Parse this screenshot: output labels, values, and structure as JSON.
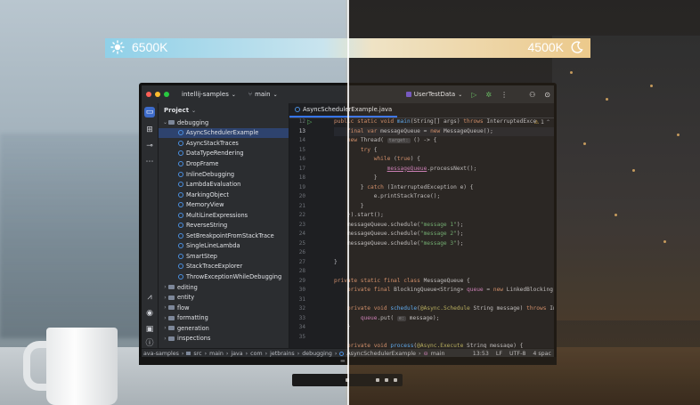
{
  "temperature": {
    "left_label": "6500K",
    "right_label": "4500K",
    "left_icon": "sun-icon",
    "right_icon": "moon-icon"
  },
  "ide": {
    "titlebar": {
      "project_name": "intellij-samples",
      "branch": "main",
      "run_config": "UserTestData"
    },
    "project_panel": {
      "title": "Project",
      "tree": [
        {
          "label": "debugging",
          "type": "folder",
          "expanded": true
        },
        {
          "label": "AsyncSchedulerExample",
          "type": "class",
          "selected": true
        },
        {
          "label": "AsyncStackTraces",
          "type": "class"
        },
        {
          "label": "DataTypeRendering",
          "type": "class"
        },
        {
          "label": "DropFrame",
          "type": "class"
        },
        {
          "label": "InlineDebugging",
          "type": "class"
        },
        {
          "label": "LambdaEvaluation",
          "type": "class"
        },
        {
          "label": "MarkingObject",
          "type": "class"
        },
        {
          "label": "MemoryView",
          "type": "class"
        },
        {
          "label": "MultiLineExpressions",
          "type": "class"
        },
        {
          "label": "ReverseString",
          "type": "class"
        },
        {
          "label": "SetBreakpointFromStackTrace",
          "type": "class"
        },
        {
          "label": "SingleLineLambda",
          "type": "class"
        },
        {
          "label": "SmartStep",
          "type": "class"
        },
        {
          "label": "StackTraceExplorer",
          "type": "class"
        },
        {
          "label": "ThrowExceptionWhileDebugging",
          "type": "class"
        },
        {
          "label": "editing",
          "type": "folder"
        },
        {
          "label": "entity",
          "type": "folder"
        },
        {
          "label": "flow",
          "type": "folder"
        },
        {
          "label": "formatting",
          "type": "folder"
        },
        {
          "label": "generation",
          "type": "folder"
        },
        {
          "label": "inspections",
          "type": "folder"
        }
      ]
    },
    "editor": {
      "tab": "AsyncSchedulerExample.java",
      "warning_count": "1",
      "line_numbers": [
        "12",
        "13",
        "14",
        "15",
        "16",
        "17",
        "18",
        "19",
        "20",
        "21",
        "22",
        "23",
        "24",
        "25",
        "26",
        "27",
        "28",
        "29",
        "30",
        "31",
        "32",
        "33",
        "34",
        "35"
      ],
      "current_line": "13"
    },
    "statusbar": {
      "breadcrumb": [
        "ava-samples",
        "src",
        "main",
        "java",
        "com",
        "jetbrains",
        "debugging",
        "AsyncSchedulerExample",
        "main"
      ],
      "position": "13:53",
      "line_sep": "LF",
      "encoding": "UTF-8",
      "indent": "4 spac"
    }
  }
}
